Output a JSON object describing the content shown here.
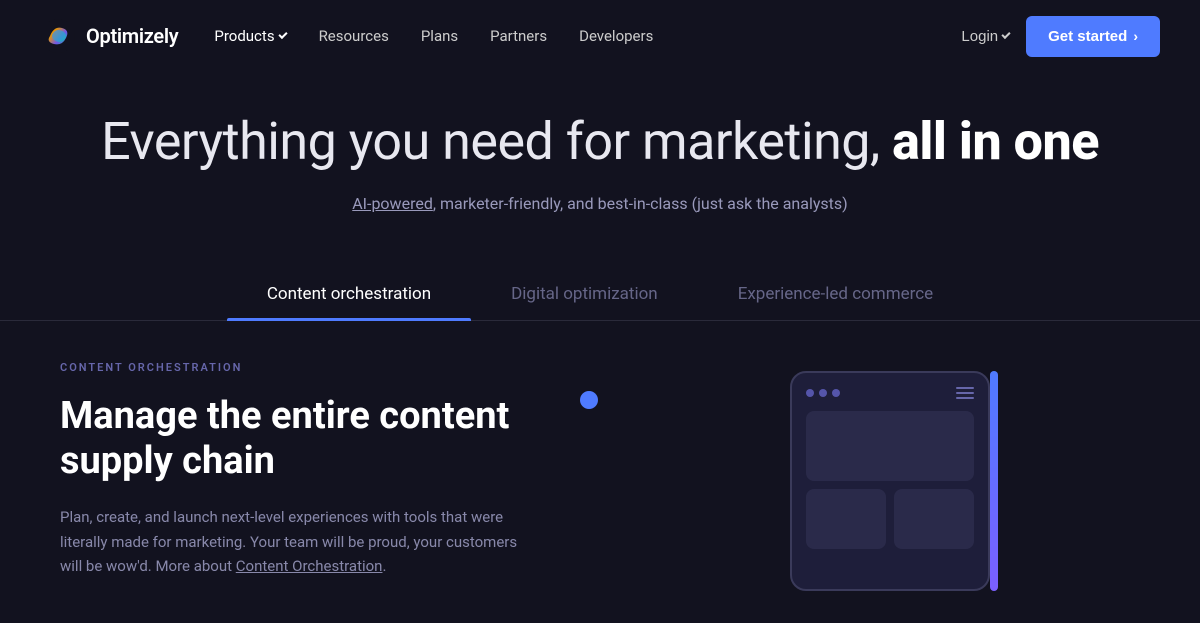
{
  "navbar": {
    "logo_text": "Optimizely",
    "nav_items": [
      {
        "label": "Products",
        "has_dropdown": true,
        "active": true
      },
      {
        "label": "Resources",
        "has_dropdown": false
      },
      {
        "label": "Plans",
        "has_dropdown": false
      },
      {
        "label": "Partners",
        "has_dropdown": false
      },
      {
        "label": "Developers",
        "has_dropdown": false
      }
    ],
    "login_label": "Login",
    "get_started_label": "Get started"
  },
  "hero": {
    "title_normal": "Everything you need for marketing,",
    "title_bold": "all in one",
    "subtitle_link": "AI-powered",
    "subtitle_rest": ", marketer-friendly, and best-in-class (just ask the analysts)"
  },
  "tabs": [
    {
      "label": "Content orchestration",
      "active": true
    },
    {
      "label": "Digital optimization",
      "active": false
    },
    {
      "label": "Experience-led commerce",
      "active": false
    }
  ],
  "content_section": {
    "section_label": "CONTENT ORCHESTRATION",
    "heading_line1": "Manage the entire content",
    "heading_line2": "supply chain",
    "body_text": "Plan, create, and launch next-level experiences with tools that were literally made for marketing. Your team will be proud, your customers will be wow'd. More about ",
    "body_link": "Content Orchestration",
    "body_trailing": "."
  }
}
